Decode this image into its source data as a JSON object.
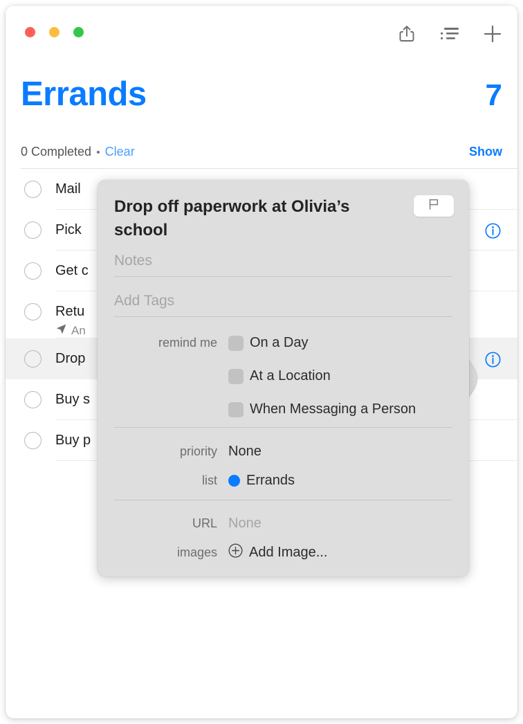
{
  "window": {
    "traffic_lights": [
      "close",
      "minimize",
      "maximize"
    ]
  },
  "toolbar": {
    "share_icon": "share-icon",
    "list_view_icon": "list-view-icon",
    "add_icon": "plus-icon"
  },
  "header": {
    "title": "Errands",
    "count": "7",
    "completed_text": "0 Completed",
    "separator": "•",
    "clear_label": "Clear",
    "show_label": "Show"
  },
  "reminders": [
    {
      "title": "Mail ",
      "subtitle": null,
      "has_info": false,
      "selected": false
    },
    {
      "title": "Pick ",
      "subtitle": null,
      "has_info": true,
      "selected": false
    },
    {
      "title": "Get c",
      "subtitle": null,
      "has_info": false,
      "selected": false
    },
    {
      "title": "Retu",
      "subtitle": "An",
      "subtitle_icon": "location-arrow-icon",
      "has_info": false,
      "selected": false
    },
    {
      "title": "Drop",
      "subtitle": null,
      "has_info": true,
      "selected": true
    },
    {
      "title": "Buy s",
      "subtitle": null,
      "has_info": false,
      "selected": false
    },
    {
      "title": "Buy p",
      "subtitle": null,
      "has_info": false,
      "selected": false
    }
  ],
  "popover": {
    "title": "Drop off paperwork at Olivia’s school",
    "flag_icon": "flag-icon",
    "notes_placeholder": "Notes",
    "tags_placeholder": "Add Tags",
    "remind_me_label": "remind me",
    "remind_options": [
      {
        "label": "On a Day",
        "checked": false
      },
      {
        "label": "At a Location",
        "checked": false
      },
      {
        "label": "When Messaging a Person",
        "checked": false
      }
    ],
    "priority_label": "priority",
    "priority_value": "None",
    "list_label": "list",
    "list_value": "Errands",
    "list_color": "#0a7cff",
    "url_label": "URL",
    "url_value": "None",
    "images_label": "images",
    "add_image_label": "Add Image..."
  },
  "colors": {
    "accent_blue": "#0a7cff",
    "popover_bg": "#dedede",
    "selected_row": "#f1f1f1",
    "traffic_red": "#fc6058",
    "traffic_yellow": "#fdbc40",
    "traffic_green": "#34c749"
  }
}
